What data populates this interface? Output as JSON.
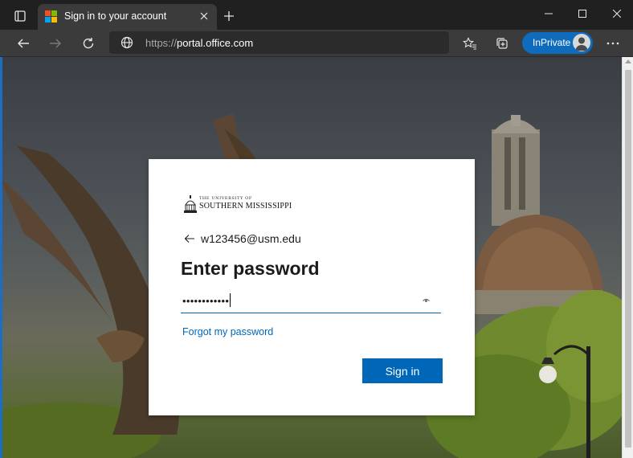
{
  "browser": {
    "tab": {
      "title": "Sign in to your account",
      "icon": "microsoft-logo"
    },
    "address": {
      "scheme": "https://",
      "host": "portal.office.com"
    },
    "inprivate_label": "InPrivate"
  },
  "signin": {
    "logo_small": "THE UNIVERSITY OF",
    "logo_big": "SOUTHERN MISSISSIPPI",
    "identity": "w123456@usm.edu",
    "heading": "Enter password",
    "password_mask": "••••••••••••",
    "forgot_link": "Forgot my password",
    "signin_button": "Sign in"
  },
  "colors": {
    "accent": "#0067b8",
    "inprivate": "#0f6cbd",
    "ms_red": "#f25022",
    "ms_green": "#7fba00",
    "ms_blue": "#00a4ef",
    "ms_yellow": "#ffb900"
  }
}
